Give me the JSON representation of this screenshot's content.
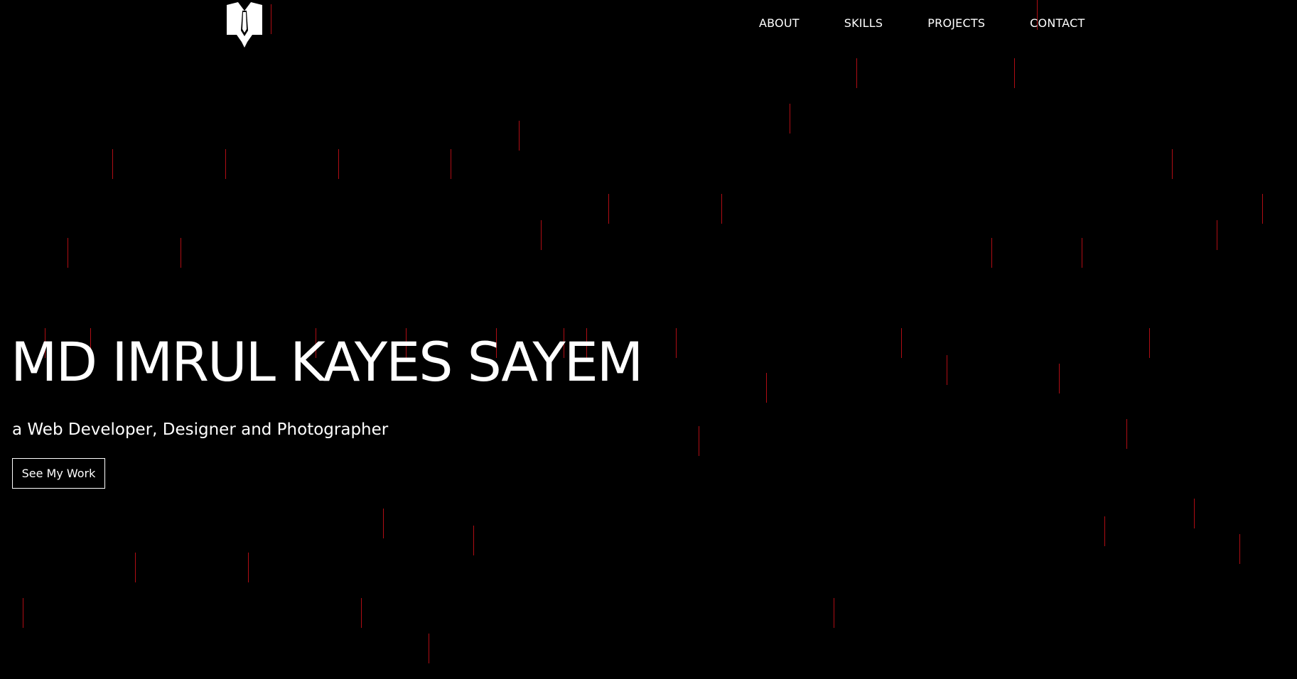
{
  "brand": {
    "logo_icon": "suit-and-tie-logo-icon"
  },
  "nav": {
    "items": [
      {
        "label": "ABOUT"
      },
      {
        "label": "SKILLS"
      },
      {
        "label": "PROJECTS"
      },
      {
        "label": "CONTACT"
      }
    ]
  },
  "hero": {
    "title": "MD IMRUL KAYES SAYEM",
    "subtitle": "a Web Developer, Designer and Photographer",
    "cta_label": "See My Work"
  },
  "colors": {
    "background": "#000000",
    "text": "#ffffff",
    "rain_accent": "#b00d14"
  }
}
